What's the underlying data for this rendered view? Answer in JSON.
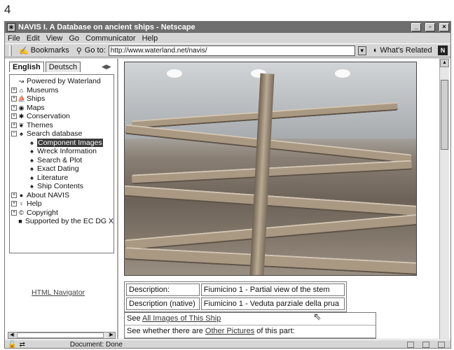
{
  "page_number": "4",
  "window": {
    "title": "NAVIS I. A Database on ancient ships - Netscape",
    "controls": {
      "minimize": "_",
      "maximize": "▫",
      "close": "×"
    }
  },
  "menu": [
    "File",
    "Edit",
    "View",
    "Go",
    "Communicator",
    "Help"
  ],
  "location": {
    "bookmarks_label": "Bookmarks",
    "goto_label": "Go to:",
    "url": "http://www.waterland.net/navis/",
    "related_label": "What's Related"
  },
  "sidebar": {
    "tabs": [
      "English",
      "Deutsch"
    ],
    "tree": [
      {
        "label": "Powered by Waterland",
        "icon": "globe-icon",
        "expand": ""
      },
      {
        "label": "Museums",
        "icon": "building-icon",
        "expand": "+"
      },
      {
        "label": "Ships",
        "icon": "ship-icon",
        "expand": "+"
      },
      {
        "label": "Maps",
        "icon": "map-icon",
        "expand": "+"
      },
      {
        "label": "Conservation",
        "icon": "gear-icon",
        "expand": "+"
      },
      {
        "label": "Themes",
        "icon": "theme-icon",
        "expand": "+"
      },
      {
        "label": "Search database",
        "icon": "binoculars-icon",
        "expand": "-"
      },
      {
        "label": "Component Images",
        "icon": "binoculars-icon",
        "child": true,
        "selected": true
      },
      {
        "label": "Wreck Information",
        "icon": "binoculars-icon",
        "child": true
      },
      {
        "label": "Search & Plot",
        "icon": "binoculars-icon",
        "child": true
      },
      {
        "label": "Exact Dating",
        "icon": "binoculars-icon",
        "child": true
      },
      {
        "label": "Literature",
        "icon": "binoculars-icon",
        "child": true
      },
      {
        "label": "Ship Contents",
        "icon": "binoculars-icon",
        "child": true
      },
      {
        "label": "About NAVIS",
        "icon": "info-icon",
        "expand": "+"
      },
      {
        "label": "Help",
        "icon": "bulb-icon",
        "expand": "+"
      },
      {
        "label": "Copyright",
        "icon": "copyright-icon",
        "expand": "+"
      },
      {
        "label": "Supported by the EC DG X",
        "icon": "flag-icon",
        "expand": ""
      }
    ],
    "html_navigator": "HTML Navigator"
  },
  "main": {
    "description_rows": [
      {
        "label": "Description:",
        "value": "Fiumicino 1 - Partial view of the stem"
      },
      {
        "label": "Description (native)",
        "value": "Fiumicino 1 - Veduta parziale della prua"
      }
    ],
    "link1_prefix": "See ",
    "link1_text": "All Images of This Ship",
    "link2_prefix": "See whether there are ",
    "link2_text": "Other Pictures",
    "link2_suffix": " of this part:"
  },
  "status": {
    "text": "Document: Done"
  }
}
